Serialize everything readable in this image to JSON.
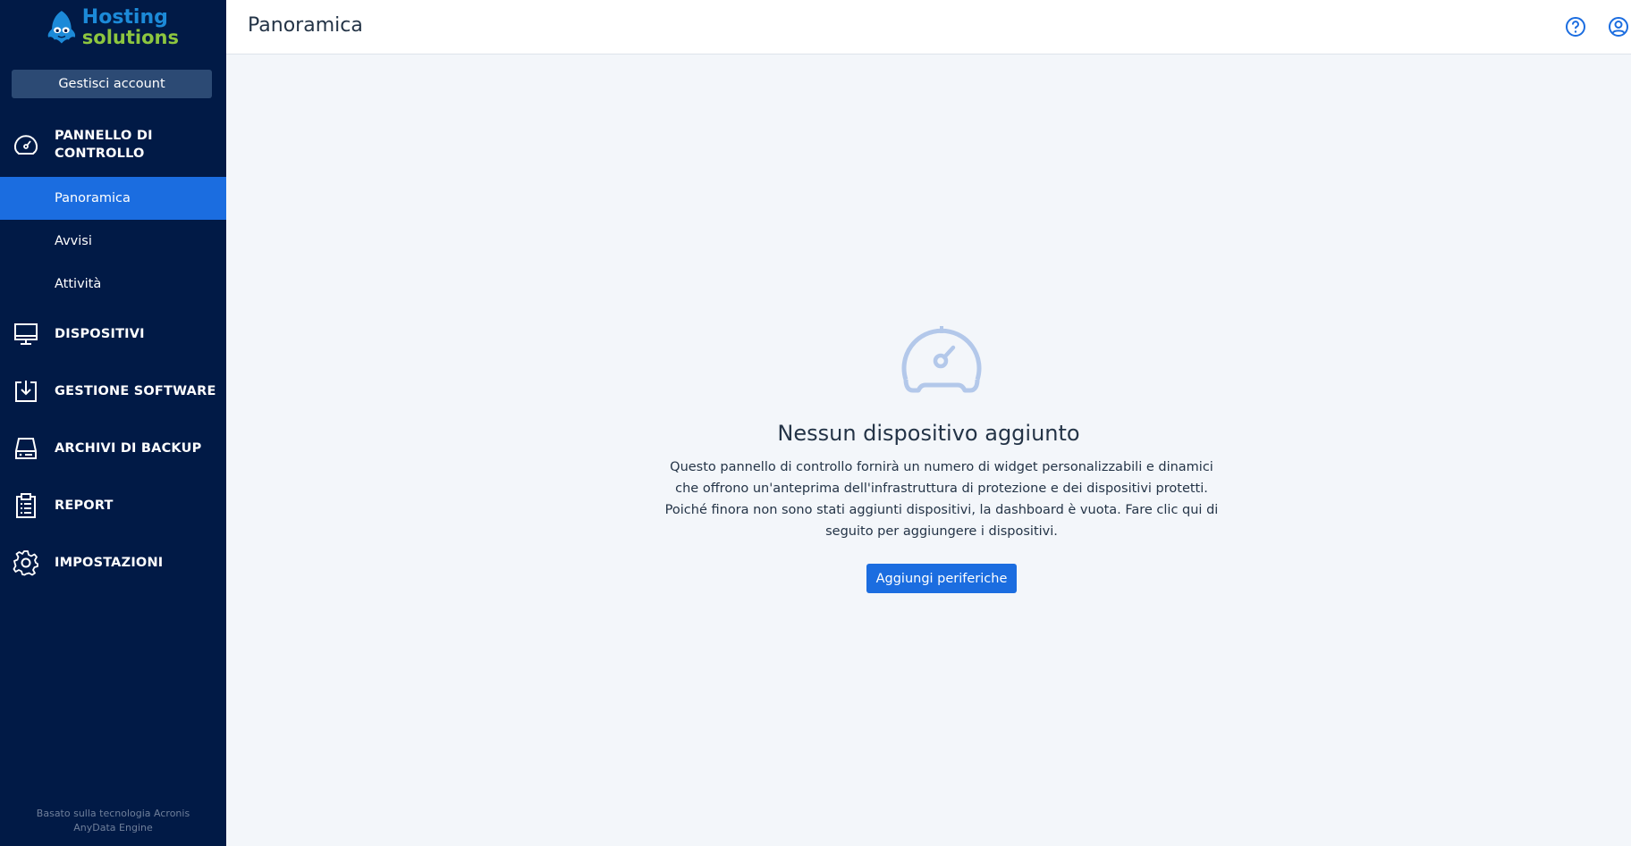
{
  "brand": {
    "line1": "Hosting",
    "line2": "solutions"
  },
  "sidebar": {
    "manage_account": "Gestisci account",
    "sections": {
      "dashboard": {
        "label": "PANNELLO DI CONTROLLO",
        "icon": "gauge-icon"
      },
      "devices": {
        "label": "DISPOSITIVI",
        "icon": "monitor-icon"
      },
      "software": {
        "label": "GESTIONE SOFTWARE",
        "icon": "download-box-icon"
      },
      "backup": {
        "label": "ARCHIVI DI BACKUP",
        "icon": "storage-icon"
      },
      "report": {
        "label": "REPORT",
        "icon": "clipboard-icon"
      },
      "settings": {
        "label": "IMPOSTAZIONI",
        "icon": "gear-icon"
      }
    },
    "subitems": [
      {
        "label": "Panoramica",
        "active": true
      },
      {
        "label": "Avvisi",
        "active": false
      },
      {
        "label": "Attività",
        "active": false
      }
    ],
    "footer": "Basato sulla tecnologia Acronis AnyData Engine"
  },
  "header": {
    "title": "Panoramica",
    "help_icon": "help-icon",
    "user_icon": "user-icon"
  },
  "empty_state": {
    "icon": "gauge-icon",
    "title": "Nessun dispositivo aggiunto",
    "text": "Questo pannello di controllo fornirà un numero di widget personalizzabili e dinamici che offrono un'anteprima dell'infrastruttura di protezione e dei dispositivi protetti. Poiché finora non sono stati aggiunti dispositivi, la dashboard è vuota. Fare clic qui di seguito per aggiungere i dispositivi.",
    "button": "Aggiungi periferiche"
  },
  "colors": {
    "sidebar_bg": "#011a46",
    "active": "#1b6de0",
    "accent": "#1b6de0",
    "brand_blue": "#1c8ad8",
    "brand_green": "#8dc63f"
  }
}
